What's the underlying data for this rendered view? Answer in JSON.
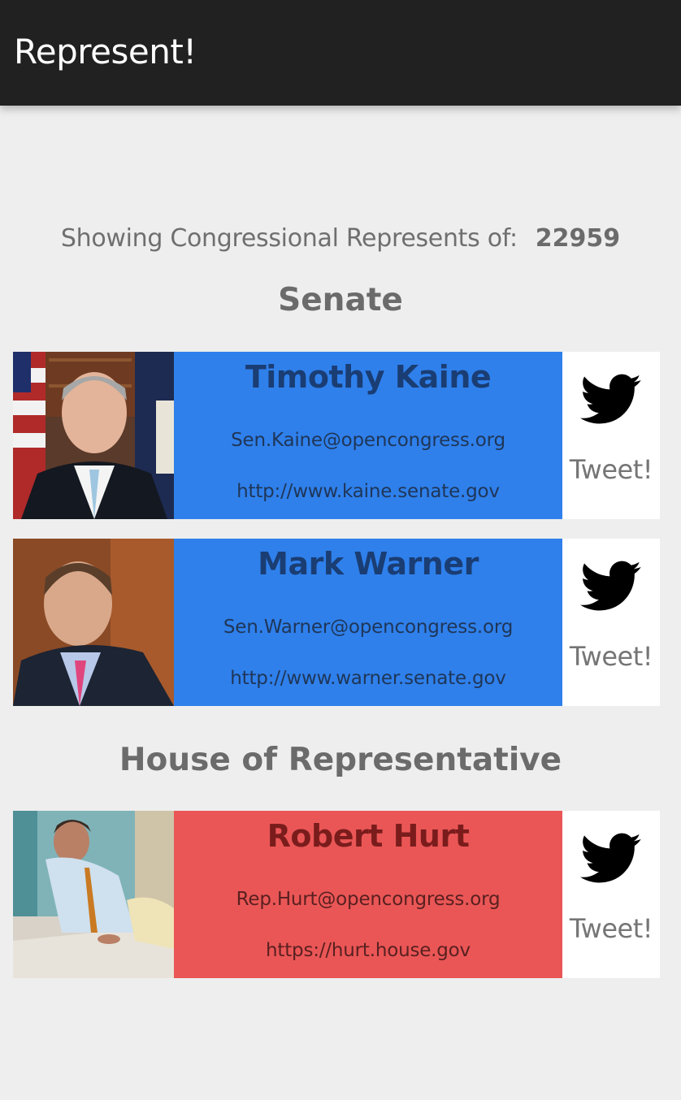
{
  "app": {
    "title": "Represent!"
  },
  "header": {
    "label": "Showing Congressional Represents of:",
    "zip": "22959"
  },
  "sections": {
    "senate": "Senate",
    "house": "House of Representative"
  },
  "colors": {
    "senate_card": "#2f80eb",
    "house_card": "#ea5656",
    "appbar": "#212121"
  },
  "representatives": [
    {
      "name": "Timothy Kaine",
      "email": "Sen.Kaine@opencongress.org",
      "website": "http://www.kaine.senate.gov",
      "tweet_label": "Tweet!",
      "chamber": "senate"
    },
    {
      "name": "Mark Warner",
      "email": "Sen.Warner@opencongress.org",
      "website": "http://www.warner.senate.gov",
      "tweet_label": "Tweet!",
      "chamber": "senate"
    },
    {
      "name": "Robert Hurt",
      "email": "Rep.Hurt@opencongress.org",
      "website": "https://hurt.house.gov",
      "tweet_label": "Tweet!",
      "chamber": "house"
    }
  ]
}
